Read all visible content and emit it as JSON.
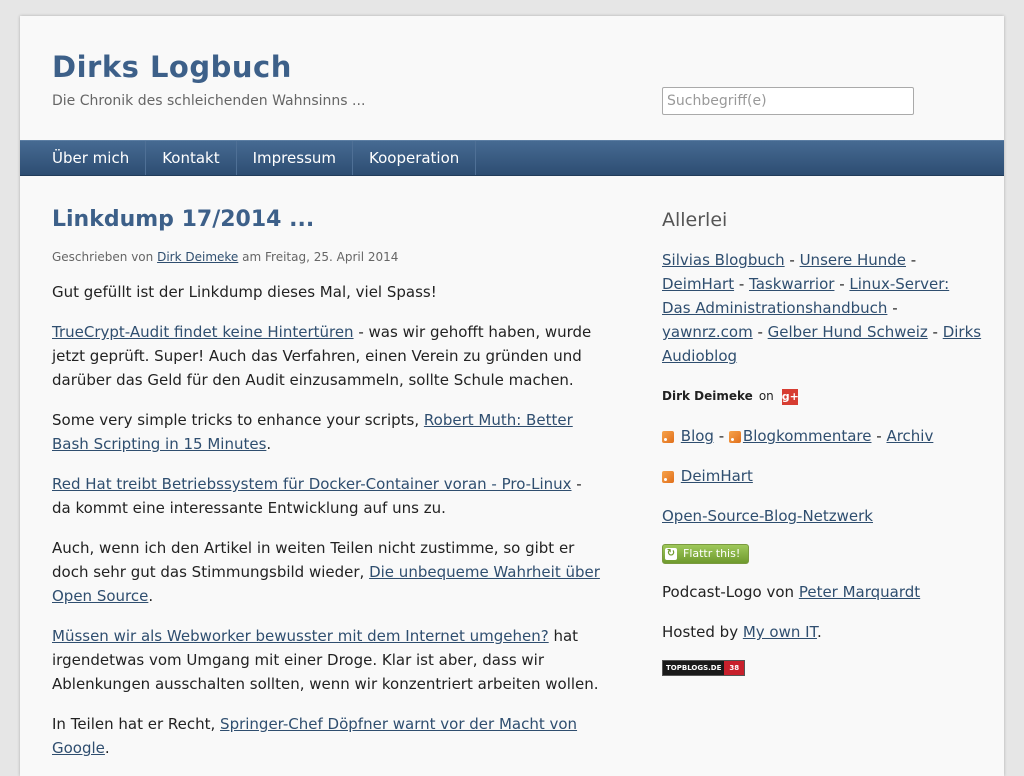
{
  "site": {
    "title": "Dirks Logbuch",
    "description": "Die Chronik des schleichenden Wahnsinns ..."
  },
  "search": {
    "placeholder": "Suchbegriff(e)"
  },
  "nav": [
    "Über mich",
    "Kontakt",
    "Impressum",
    "Kooperation"
  ],
  "post": {
    "title": "Linkdump 17/2014 ...",
    "byline": {
      "prefix": "Geschrieben von",
      "author": "Dirk Deimeke",
      "date": "am Freitag, 25. April 2014"
    },
    "intro": "Gut gefüllt ist der Linkdump dieses Mal, viel Spass!",
    "p1": {
      "link": "TrueCrypt-Audit findet keine Hintertüren",
      "text": " - was wir gehofft haben, wurde jetzt geprüft. Super! Auch das Verfahren, einen Verein zu gründen und darüber das Geld für den Audit einzusammeln, sollte Schule machen."
    },
    "p2": {
      "pre": "Some very simple tricks to enhance your scripts, ",
      "link": "Robert Muth: Better Bash Scripting in 15 Minutes",
      "post": "."
    },
    "p3": {
      "link": "Red Hat treibt Betriebssystem für Docker-Container voran - Pro-Linux",
      "text": " - da kommt eine interessante Entwicklung auf uns zu."
    },
    "p4": {
      "pre": "Auch, wenn ich den Artikel in weiten Teilen nicht zustimme, so gibt er doch sehr gut das Stimmungsbild wieder, ",
      "link": "Die unbequeme Wahrheit über Open Source",
      "post": "."
    },
    "p5": {
      "link": "Müssen wir als Webworker bewusster mit dem Internet umgehen?",
      "text": " hat irgend­etwas vom Umgang mit einer Droge. Klar ist aber, dass wir Ablenkungen ausschalten sollten, wenn wir konzentriert arbeiten wollen."
    },
    "p6": {
      "pre": "In Teilen hat er Recht, ",
      "link": "Springer-Chef Döpfner warnt vor der Macht von Goog­le",
      "post": "."
    }
  },
  "sidebar": {
    "title": "Allerlei",
    "links": [
      "Silvias Blogbuch",
      "Unsere Hunde",
      "DeimHart",
      "Taskwarrior",
      "Linux-Server: Das Administrationshandbuch",
      "yawnrz.com",
      "Gelber Hund Schweiz",
      "Dirks Audioblog"
    ],
    "gplus": {
      "name": "Dirk Deimeke",
      "on": "on",
      "icon": "g+"
    },
    "feeds": {
      "blog": "Blog",
      "comments": "Blogkommentare",
      "archive": "Archiv",
      "deimhart": "DeimHart"
    },
    "network": "Open-Source-Blog-Netzwerk",
    "flattr": "Flattr this!",
    "podcast": {
      "text": "Podcast-Logo von ",
      "link": "Peter Marquardt"
    },
    "hosted": {
      "text": "Hosted by ",
      "link": "My own IT",
      "post": "."
    },
    "badge": {
      "left": "TOPBLOGS.DE",
      "right": "38"
    }
  },
  "colors": {
    "title": "#3d6089",
    "nav": "#2d4d72",
    "link": "#2f4e6f"
  }
}
